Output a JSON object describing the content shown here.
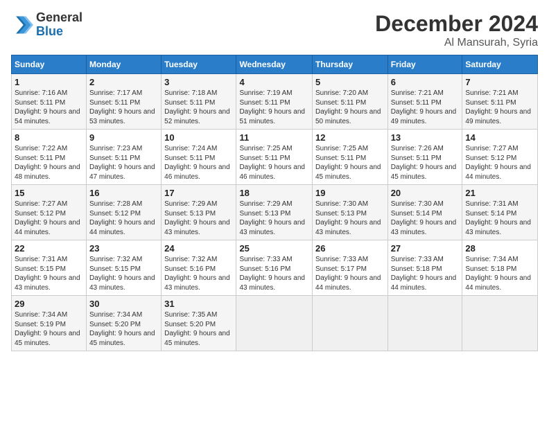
{
  "header": {
    "logo_general": "General",
    "logo_blue": "Blue",
    "month": "December 2024",
    "location": "Al Mansurah, Syria"
  },
  "weekdays": [
    "Sunday",
    "Monday",
    "Tuesday",
    "Wednesday",
    "Thursday",
    "Friday",
    "Saturday"
  ],
  "weeks": [
    [
      {
        "day": "1",
        "sunrise": "Sunrise: 7:16 AM",
        "sunset": "Sunset: 5:11 PM",
        "daylight": "Daylight: 9 hours and 54 minutes."
      },
      {
        "day": "2",
        "sunrise": "Sunrise: 7:17 AM",
        "sunset": "Sunset: 5:11 PM",
        "daylight": "Daylight: 9 hours and 53 minutes."
      },
      {
        "day": "3",
        "sunrise": "Sunrise: 7:18 AM",
        "sunset": "Sunset: 5:11 PM",
        "daylight": "Daylight: 9 hours and 52 minutes."
      },
      {
        "day": "4",
        "sunrise": "Sunrise: 7:19 AM",
        "sunset": "Sunset: 5:11 PM",
        "daylight": "Daylight: 9 hours and 51 minutes."
      },
      {
        "day": "5",
        "sunrise": "Sunrise: 7:20 AM",
        "sunset": "Sunset: 5:11 PM",
        "daylight": "Daylight: 9 hours and 50 minutes."
      },
      {
        "day": "6",
        "sunrise": "Sunrise: 7:21 AM",
        "sunset": "Sunset: 5:11 PM",
        "daylight": "Daylight: 9 hours and 49 minutes."
      },
      {
        "day": "7",
        "sunrise": "Sunrise: 7:21 AM",
        "sunset": "Sunset: 5:11 PM",
        "daylight": "Daylight: 9 hours and 49 minutes."
      }
    ],
    [
      {
        "day": "8",
        "sunrise": "Sunrise: 7:22 AM",
        "sunset": "Sunset: 5:11 PM",
        "daylight": "Daylight: 9 hours and 48 minutes."
      },
      {
        "day": "9",
        "sunrise": "Sunrise: 7:23 AM",
        "sunset": "Sunset: 5:11 PM",
        "daylight": "Daylight: 9 hours and 47 minutes."
      },
      {
        "day": "10",
        "sunrise": "Sunrise: 7:24 AM",
        "sunset": "Sunset: 5:11 PM",
        "daylight": "Daylight: 9 hours and 46 minutes."
      },
      {
        "day": "11",
        "sunrise": "Sunrise: 7:25 AM",
        "sunset": "Sunset: 5:11 PM",
        "daylight": "Daylight: 9 hours and 46 minutes."
      },
      {
        "day": "12",
        "sunrise": "Sunrise: 7:25 AM",
        "sunset": "Sunset: 5:11 PM",
        "daylight": "Daylight: 9 hours and 45 minutes."
      },
      {
        "day": "13",
        "sunrise": "Sunrise: 7:26 AM",
        "sunset": "Sunset: 5:11 PM",
        "daylight": "Daylight: 9 hours and 45 minutes."
      },
      {
        "day": "14",
        "sunrise": "Sunrise: 7:27 AM",
        "sunset": "Sunset: 5:12 PM",
        "daylight": "Daylight: 9 hours and 44 minutes."
      }
    ],
    [
      {
        "day": "15",
        "sunrise": "Sunrise: 7:27 AM",
        "sunset": "Sunset: 5:12 PM",
        "daylight": "Daylight: 9 hours and 44 minutes."
      },
      {
        "day": "16",
        "sunrise": "Sunrise: 7:28 AM",
        "sunset": "Sunset: 5:12 PM",
        "daylight": "Daylight: 9 hours and 44 minutes."
      },
      {
        "day": "17",
        "sunrise": "Sunrise: 7:29 AM",
        "sunset": "Sunset: 5:13 PM",
        "daylight": "Daylight: 9 hours and 43 minutes."
      },
      {
        "day": "18",
        "sunrise": "Sunrise: 7:29 AM",
        "sunset": "Sunset: 5:13 PM",
        "daylight": "Daylight: 9 hours and 43 minutes."
      },
      {
        "day": "19",
        "sunrise": "Sunrise: 7:30 AM",
        "sunset": "Sunset: 5:13 PM",
        "daylight": "Daylight: 9 hours and 43 minutes."
      },
      {
        "day": "20",
        "sunrise": "Sunrise: 7:30 AM",
        "sunset": "Sunset: 5:14 PM",
        "daylight": "Daylight: 9 hours and 43 minutes."
      },
      {
        "day": "21",
        "sunrise": "Sunrise: 7:31 AM",
        "sunset": "Sunset: 5:14 PM",
        "daylight": "Daylight: 9 hours and 43 minutes."
      }
    ],
    [
      {
        "day": "22",
        "sunrise": "Sunrise: 7:31 AM",
        "sunset": "Sunset: 5:15 PM",
        "daylight": "Daylight: 9 hours and 43 minutes."
      },
      {
        "day": "23",
        "sunrise": "Sunrise: 7:32 AM",
        "sunset": "Sunset: 5:15 PM",
        "daylight": "Daylight: 9 hours and 43 minutes."
      },
      {
        "day": "24",
        "sunrise": "Sunrise: 7:32 AM",
        "sunset": "Sunset: 5:16 PM",
        "daylight": "Daylight: 9 hours and 43 minutes."
      },
      {
        "day": "25",
        "sunrise": "Sunrise: 7:33 AM",
        "sunset": "Sunset: 5:16 PM",
        "daylight": "Daylight: 9 hours and 43 minutes."
      },
      {
        "day": "26",
        "sunrise": "Sunrise: 7:33 AM",
        "sunset": "Sunset: 5:17 PM",
        "daylight": "Daylight: 9 hours and 44 minutes."
      },
      {
        "day": "27",
        "sunrise": "Sunrise: 7:33 AM",
        "sunset": "Sunset: 5:18 PM",
        "daylight": "Daylight: 9 hours and 44 minutes."
      },
      {
        "day": "28",
        "sunrise": "Sunrise: 7:34 AM",
        "sunset": "Sunset: 5:18 PM",
        "daylight": "Daylight: 9 hours and 44 minutes."
      }
    ],
    [
      {
        "day": "29",
        "sunrise": "Sunrise: 7:34 AM",
        "sunset": "Sunset: 5:19 PM",
        "daylight": "Daylight: 9 hours and 45 minutes."
      },
      {
        "day": "30",
        "sunrise": "Sunrise: 7:34 AM",
        "sunset": "Sunset: 5:20 PM",
        "daylight": "Daylight: 9 hours and 45 minutes."
      },
      {
        "day": "31",
        "sunrise": "Sunrise: 7:35 AM",
        "sunset": "Sunset: 5:20 PM",
        "daylight": "Daylight: 9 hours and 45 minutes."
      },
      null,
      null,
      null,
      null
    ]
  ]
}
